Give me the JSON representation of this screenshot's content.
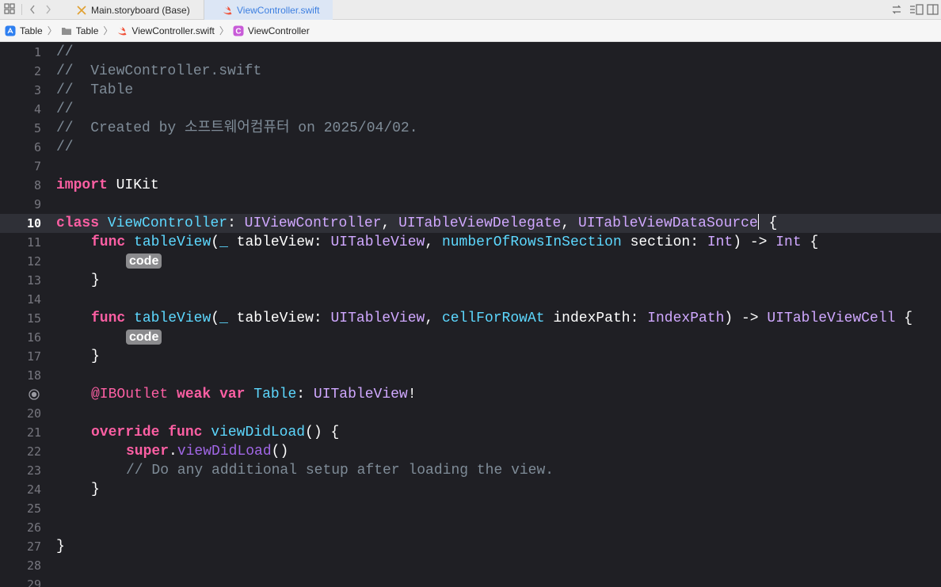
{
  "tabbar": {
    "tabs": [
      {
        "label": "Main.storyboard (Base)",
        "icon": "storyboard-icon"
      },
      {
        "label": "ViewController.swift",
        "icon": "swift-file-icon",
        "active": true
      }
    ]
  },
  "breadcrumb": {
    "items": [
      {
        "label": "Table",
        "icon": "project-icon"
      },
      {
        "label": "Table",
        "icon": "folder-icon"
      },
      {
        "label": "ViewController.swift",
        "icon": "swift-file-icon"
      },
      {
        "label": "ViewController",
        "icon": "class-icon"
      }
    ]
  },
  "editor": {
    "current_line": "10",
    "breakpoint_line": "19",
    "lines": [
      {
        "n": "1",
        "tokens": [
          {
            "t": "//",
            "k": "comment"
          }
        ]
      },
      {
        "n": "2",
        "tokens": [
          {
            "t": "//  ViewController.swift",
            "k": "comment"
          }
        ]
      },
      {
        "n": "3",
        "tokens": [
          {
            "t": "//  Table",
            "k": "comment"
          }
        ]
      },
      {
        "n": "4",
        "tokens": [
          {
            "t": "//",
            "k": "comment"
          }
        ]
      },
      {
        "n": "5",
        "tokens": [
          {
            "t": "//  Created by 소프트웨어컴퓨터 on 2025/04/02.",
            "k": "comment"
          }
        ]
      },
      {
        "n": "6",
        "tokens": [
          {
            "t": "//",
            "k": "comment"
          }
        ]
      },
      {
        "n": "7",
        "tokens": []
      },
      {
        "n": "8",
        "tokens": [
          {
            "t": "import",
            "k": "kw"
          },
          {
            "t": " UIKit",
            "k": "plain"
          }
        ]
      },
      {
        "n": "9",
        "tokens": []
      },
      {
        "n": "10",
        "tokens": [
          {
            "t": "class",
            "k": "kw"
          },
          {
            "t": " ",
            "k": "plain"
          },
          {
            "t": "ViewController",
            "k": "decl"
          },
          {
            "t": ": ",
            "k": "plain"
          },
          {
            "t": "UIViewController",
            "k": "type"
          },
          {
            "t": ", ",
            "k": "plain"
          },
          {
            "t": "UITableViewDelegate",
            "k": "type"
          },
          {
            "t": ", ",
            "k": "plain"
          },
          {
            "t": "UITableViewDataSource",
            "k": "type"
          },
          {
            "t": "",
            "k": "cursor"
          },
          {
            "t": " {",
            "k": "plain"
          }
        ]
      },
      {
        "n": "11",
        "indent": 1,
        "tokens": [
          {
            "t": "func",
            "k": "kw"
          },
          {
            "t": " ",
            "k": "plain"
          },
          {
            "t": "tableView",
            "k": "decl"
          },
          {
            "t": "(",
            "k": "plain"
          },
          {
            "t": "_",
            "k": "decl"
          },
          {
            "t": " tableView: ",
            "k": "plain"
          },
          {
            "t": "UITableView",
            "k": "type"
          },
          {
            "t": ", ",
            "k": "plain"
          },
          {
            "t": "numberOfRowsInSection",
            "k": "decl"
          },
          {
            "t": " section: ",
            "k": "plain"
          },
          {
            "t": "Int",
            "k": "type"
          },
          {
            "t": ") -> ",
            "k": "plain"
          },
          {
            "t": "Int",
            "k": "type"
          },
          {
            "t": " {",
            "k": "plain"
          }
        ]
      },
      {
        "n": "12",
        "indent": 2,
        "tokens": [
          {
            "t": "code",
            "k": "placeholder"
          }
        ]
      },
      {
        "n": "13",
        "indent": 1,
        "tokens": [
          {
            "t": "}",
            "k": "plain"
          }
        ]
      },
      {
        "n": "14",
        "tokens": []
      },
      {
        "n": "15",
        "indent": 1,
        "tokens": [
          {
            "t": "func",
            "k": "kw"
          },
          {
            "t": " ",
            "k": "plain"
          },
          {
            "t": "tableView",
            "k": "decl"
          },
          {
            "t": "(",
            "k": "plain"
          },
          {
            "t": "_",
            "k": "decl"
          },
          {
            "t": " tableView: ",
            "k": "plain"
          },
          {
            "t": "UITableView",
            "k": "type"
          },
          {
            "t": ", ",
            "k": "plain"
          },
          {
            "t": "cellForRowAt",
            "k": "decl"
          },
          {
            "t": " indexPath: ",
            "k": "plain"
          },
          {
            "t": "IndexPath",
            "k": "type"
          },
          {
            "t": ") -> ",
            "k": "plain"
          },
          {
            "t": "UITableViewCell",
            "k": "type"
          },
          {
            "t": " {",
            "k": "plain"
          }
        ]
      },
      {
        "n": "16",
        "indent": 2,
        "tokens": [
          {
            "t": "code",
            "k": "placeholder"
          }
        ]
      },
      {
        "n": "17",
        "indent": 1,
        "tokens": [
          {
            "t": "}",
            "k": "plain"
          }
        ]
      },
      {
        "n": "18",
        "tokens": []
      },
      {
        "n": "19",
        "indent": 1,
        "tokens": [
          {
            "t": "@IBOutlet",
            "k": "attr"
          },
          {
            "t": " ",
            "k": "plain"
          },
          {
            "t": "weak",
            "k": "kw"
          },
          {
            "t": " ",
            "k": "plain"
          },
          {
            "t": "var",
            "k": "kw"
          },
          {
            "t": " ",
            "k": "plain"
          },
          {
            "t": "Table",
            "k": "decl"
          },
          {
            "t": ": ",
            "k": "plain"
          },
          {
            "t": "UITableView",
            "k": "type"
          },
          {
            "t": "!",
            "k": "plain"
          }
        ]
      },
      {
        "n": "20",
        "tokens": []
      },
      {
        "n": "21",
        "indent": 1,
        "tokens": [
          {
            "t": "override",
            "k": "kw"
          },
          {
            "t": " ",
            "k": "plain"
          },
          {
            "t": "func",
            "k": "kw"
          },
          {
            "t": " ",
            "k": "plain"
          },
          {
            "t": "viewDidLoad",
            "k": "decl"
          },
          {
            "t": "() {",
            "k": "plain"
          }
        ]
      },
      {
        "n": "22",
        "indent": 2,
        "tokens": [
          {
            "t": "super",
            "k": "kw"
          },
          {
            "t": ".",
            "k": "plain"
          },
          {
            "t": "viewDidLoad",
            "k": "call"
          },
          {
            "t": "()",
            "k": "plain"
          }
        ]
      },
      {
        "n": "23",
        "indent": 2,
        "tokens": [
          {
            "t": "// Do any additional setup after loading the view.",
            "k": "comment"
          }
        ]
      },
      {
        "n": "24",
        "indent": 1,
        "tokens": [
          {
            "t": "}",
            "k": "plain"
          }
        ]
      },
      {
        "n": "25",
        "tokens": []
      },
      {
        "n": "26",
        "tokens": []
      },
      {
        "n": "27",
        "tokens": [
          {
            "t": "}",
            "k": "plain"
          }
        ]
      },
      {
        "n": "28",
        "tokens": []
      },
      {
        "n": "29",
        "tokens": []
      }
    ]
  }
}
